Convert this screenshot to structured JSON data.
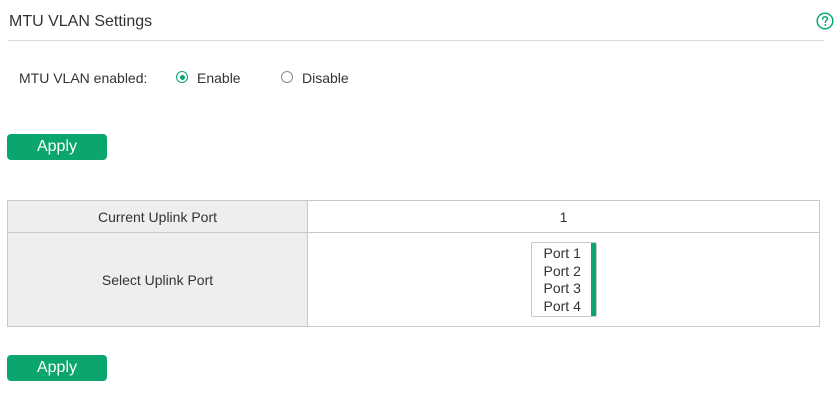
{
  "page": {
    "title": "MTU VLAN Settings",
    "help_icon": "help-circle-icon",
    "accent_color": "#0aa66e"
  },
  "mtu_vlan": {
    "label": "MTU VLAN enabled:",
    "options": [
      {
        "label": "Enable",
        "selected": true
      },
      {
        "label": "Disable",
        "selected": false
      }
    ]
  },
  "buttons": {
    "apply_top": "Apply",
    "apply_bottom": "Apply"
  },
  "uplink_table": {
    "current_label": "Current Uplink Port",
    "current_value": "1",
    "select_label": "Select Uplink Port",
    "port_options": [
      "Port 1",
      "Port 2",
      "Port 3",
      "Port 4"
    ]
  }
}
